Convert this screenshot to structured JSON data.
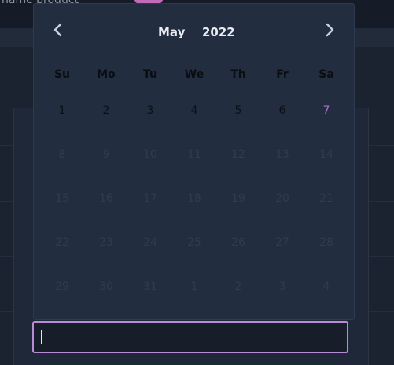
{
  "background": {
    "field_label": "name product"
  },
  "calendar": {
    "month": "May",
    "year": "2022",
    "weekdays": [
      "Su",
      "Mo",
      "Tu",
      "We",
      "Th",
      "Fr",
      "Sa"
    ],
    "weeks": [
      [
        "1",
        "2",
        "3",
        "4",
        "5",
        "6",
        "7"
      ],
      [
        "8",
        "9",
        "10",
        "11",
        "12",
        "13",
        "14"
      ],
      [
        "15",
        "16",
        "17",
        "18",
        "19",
        "20",
        "21"
      ],
      [
        "22",
        "23",
        "24",
        "25",
        "26",
        "27",
        "28"
      ],
      [
        "29",
        "30",
        "31",
        "1",
        "2",
        "3",
        "4"
      ]
    ],
    "highlighted_day": "7",
    "colors": {
      "accent": "#a874c8",
      "input_border": "#b98ad8"
    }
  },
  "date_input": {
    "value": ""
  }
}
